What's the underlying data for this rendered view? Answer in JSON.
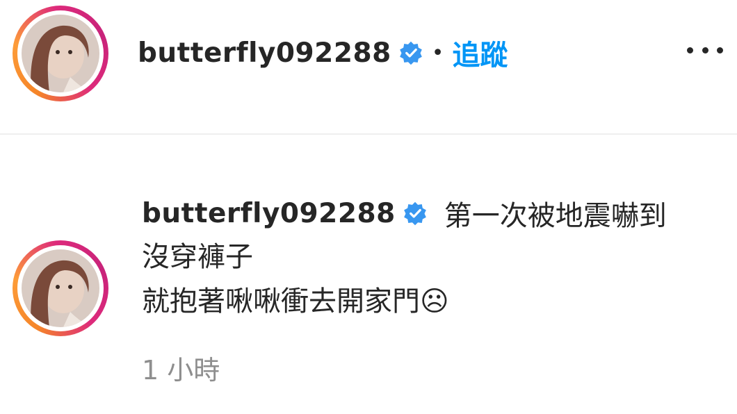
{
  "post_header": {
    "username": "butterfly092288",
    "separator": "•",
    "follow_label": "追蹤",
    "more_icon": "more-options-icon"
  },
  "comment": {
    "username": "butterfly092288",
    "caption_first": "第一次被地震嚇到",
    "caption_rest": "沒穿褲子\n就抱著啾啾衝去開家門☹",
    "timestamp": "1 小時"
  },
  "icons": {
    "verified": "verified-badge-icon",
    "avatar": "avatar"
  },
  "colors": {
    "follow_blue": "#0095f6",
    "verified_blue": "#3897f0",
    "text": "#262626",
    "muted": "#8e8e8e",
    "ring_orange": "#f58529",
    "ring_pink": "#dd2a7b"
  }
}
